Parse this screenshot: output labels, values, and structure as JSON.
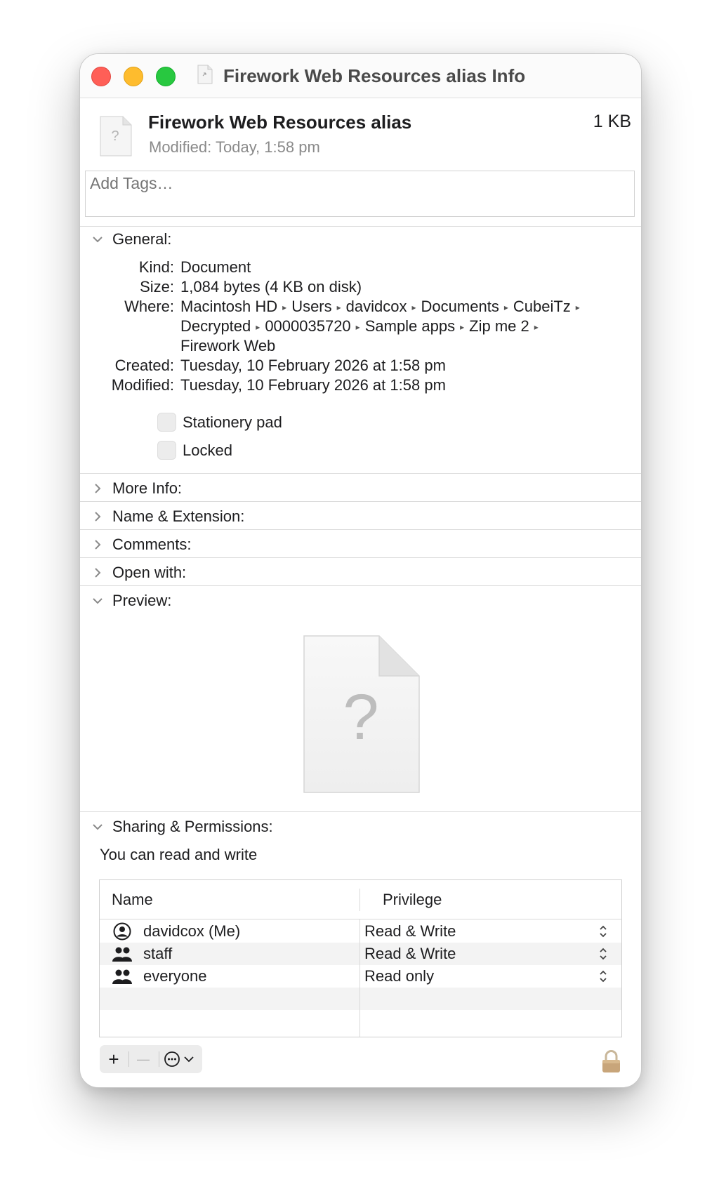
{
  "window": {
    "title": "Firework Web Resources alias Info"
  },
  "header": {
    "name": "Firework Web Resources alias",
    "size": "1 KB",
    "modified": "Modified:  Today, 1:58 pm",
    "tags_placeholder": "Add Tags…"
  },
  "general": {
    "title": "General:",
    "kind_label": "Kind:",
    "kind": "Document",
    "size_label": "Size:",
    "size": "1,084 bytes (4 KB on disk)",
    "where_label": "Where:",
    "where_lines": [
      [
        "Macintosh HD",
        "Users",
        "davidcox",
        "Documents",
        "CubeiTz"
      ],
      [
        "Decrypted",
        "0000035720",
        "Sample apps",
        "Zip me 2"
      ],
      [
        "Firework Web"
      ]
    ],
    "created_label": "Created:",
    "created": "Tuesday, 10 February 2026 at 1:58 pm",
    "modified_label": "Modified:",
    "modified": "Tuesday, 10 February 2026 at 1:58 pm",
    "stationery_label": "Stationery pad",
    "locked_label": "Locked"
  },
  "sections": {
    "more_info": "More Info:",
    "name_ext": "Name & Extension:",
    "comments": "Comments:",
    "open_with": "Open with:",
    "preview": "Preview:",
    "sharing": "Sharing & Permissions:"
  },
  "sharing": {
    "note": "You can read and write",
    "col_name": "Name",
    "col_privilege": "Privilege",
    "rows": [
      {
        "name": "davidcox (Me)",
        "privilege": "Read & Write"
      },
      {
        "name": "staff",
        "privilege": "Read & Write"
      },
      {
        "name": "everyone",
        "privilege": "Read only"
      }
    ]
  },
  "toolbar": {
    "add": "+",
    "remove": "—"
  },
  "colors": {
    "close": "#ff5f57",
    "minimize": "#febc2e",
    "zoom": "#28c840"
  }
}
